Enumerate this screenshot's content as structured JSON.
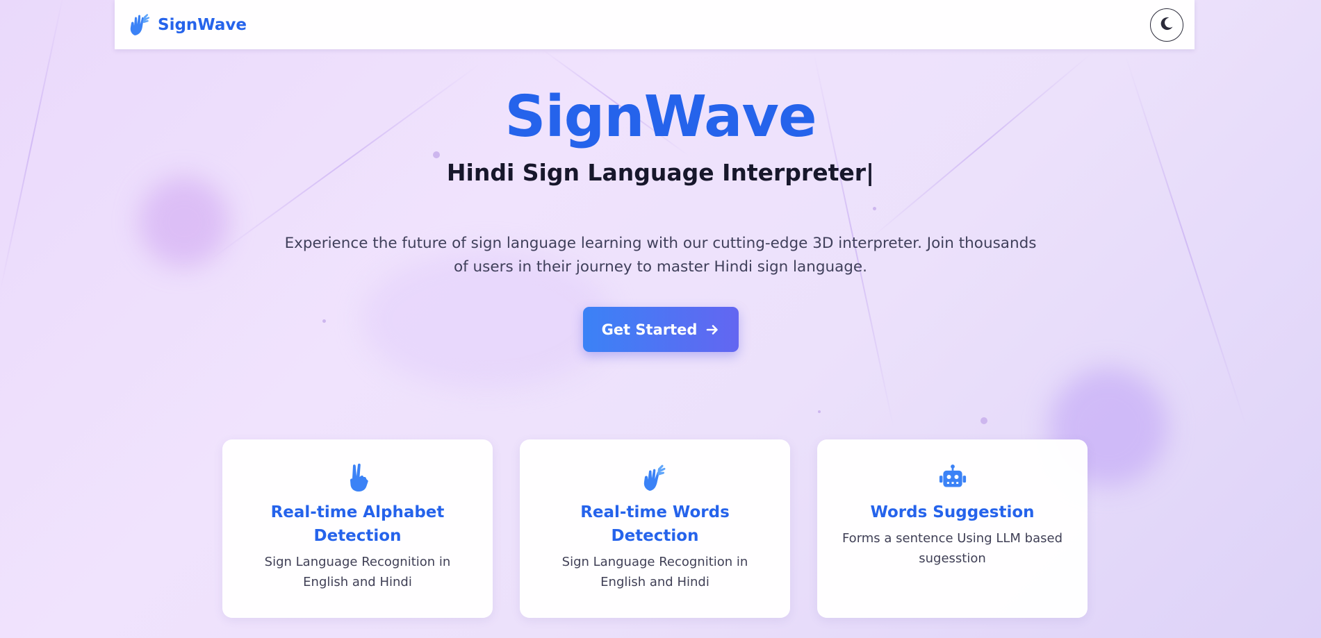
{
  "brand": {
    "name": "SignWave",
    "icon": "hands-icon"
  },
  "theme_toggle": {
    "icon": "moon-icon"
  },
  "hero": {
    "title": "SignWave",
    "subtitle": "Hindi Sign Language Interpreter|",
    "description": "Experience the future of sign language learning with our cutting-edge 3D interpreter. Join thousands of users in their journey to master Hindi sign language.",
    "cta_label": "Get Started",
    "cta_icon": "arrow-right-icon"
  },
  "features": [
    {
      "icon": "peace-hand-icon",
      "title": "Real-time Alphabet Detection",
      "description": "Sign Language Recognition in English and Hindi"
    },
    {
      "icon": "sign-hands-icon",
      "title": "Real-time Words Detection",
      "description": "Sign Language Recognition in English and Hindi"
    },
    {
      "icon": "robot-icon",
      "title": "Words Suggestion",
      "description": "Forms a sentence Using LLM based sugesstion"
    }
  ],
  "colors": {
    "accent": "#2563eb",
    "cta_start": "#3b82f6",
    "cta_end": "#6366f1",
    "background": "#ede0fc"
  }
}
